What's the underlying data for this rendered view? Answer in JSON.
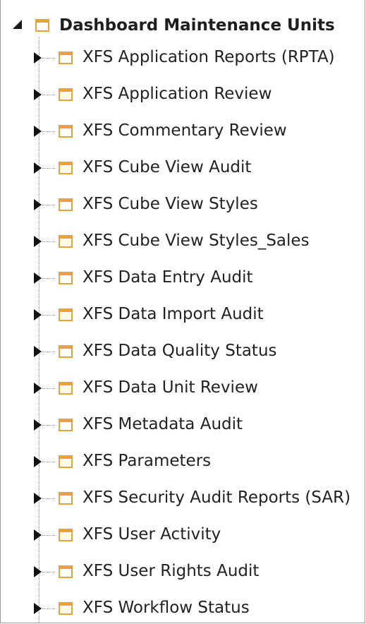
{
  "tree": {
    "root": {
      "label": "Dashboard Maintenance Units",
      "icon": "folder-icon",
      "expanded": true
    },
    "children": [
      {
        "label": "XFS Application Reports (RPTA)"
      },
      {
        "label": "XFS Application Review"
      },
      {
        "label": "XFS Commentary Review"
      },
      {
        "label": "XFS Cube View Audit"
      },
      {
        "label": "XFS Cube View Styles"
      },
      {
        "label": "XFS Cube View Styles_Sales"
      },
      {
        "label": "XFS Data Entry Audit"
      },
      {
        "label": "XFS Data Import Audit"
      },
      {
        "label": "XFS Data Quality Status"
      },
      {
        "label": "XFS Data Unit Review"
      },
      {
        "label": "XFS Metadata Audit"
      },
      {
        "label": "XFS Parameters"
      },
      {
        "label": "XFS Security Audit Reports (SAR)"
      },
      {
        "label": "XFS User Activity"
      },
      {
        "label": "XFS User Rights Audit"
      },
      {
        "label": "XFS Workflow Status"
      }
    ]
  },
  "colors": {
    "folder": "#e8a23a",
    "text": "#222222",
    "connector": "#9a9a9a"
  }
}
